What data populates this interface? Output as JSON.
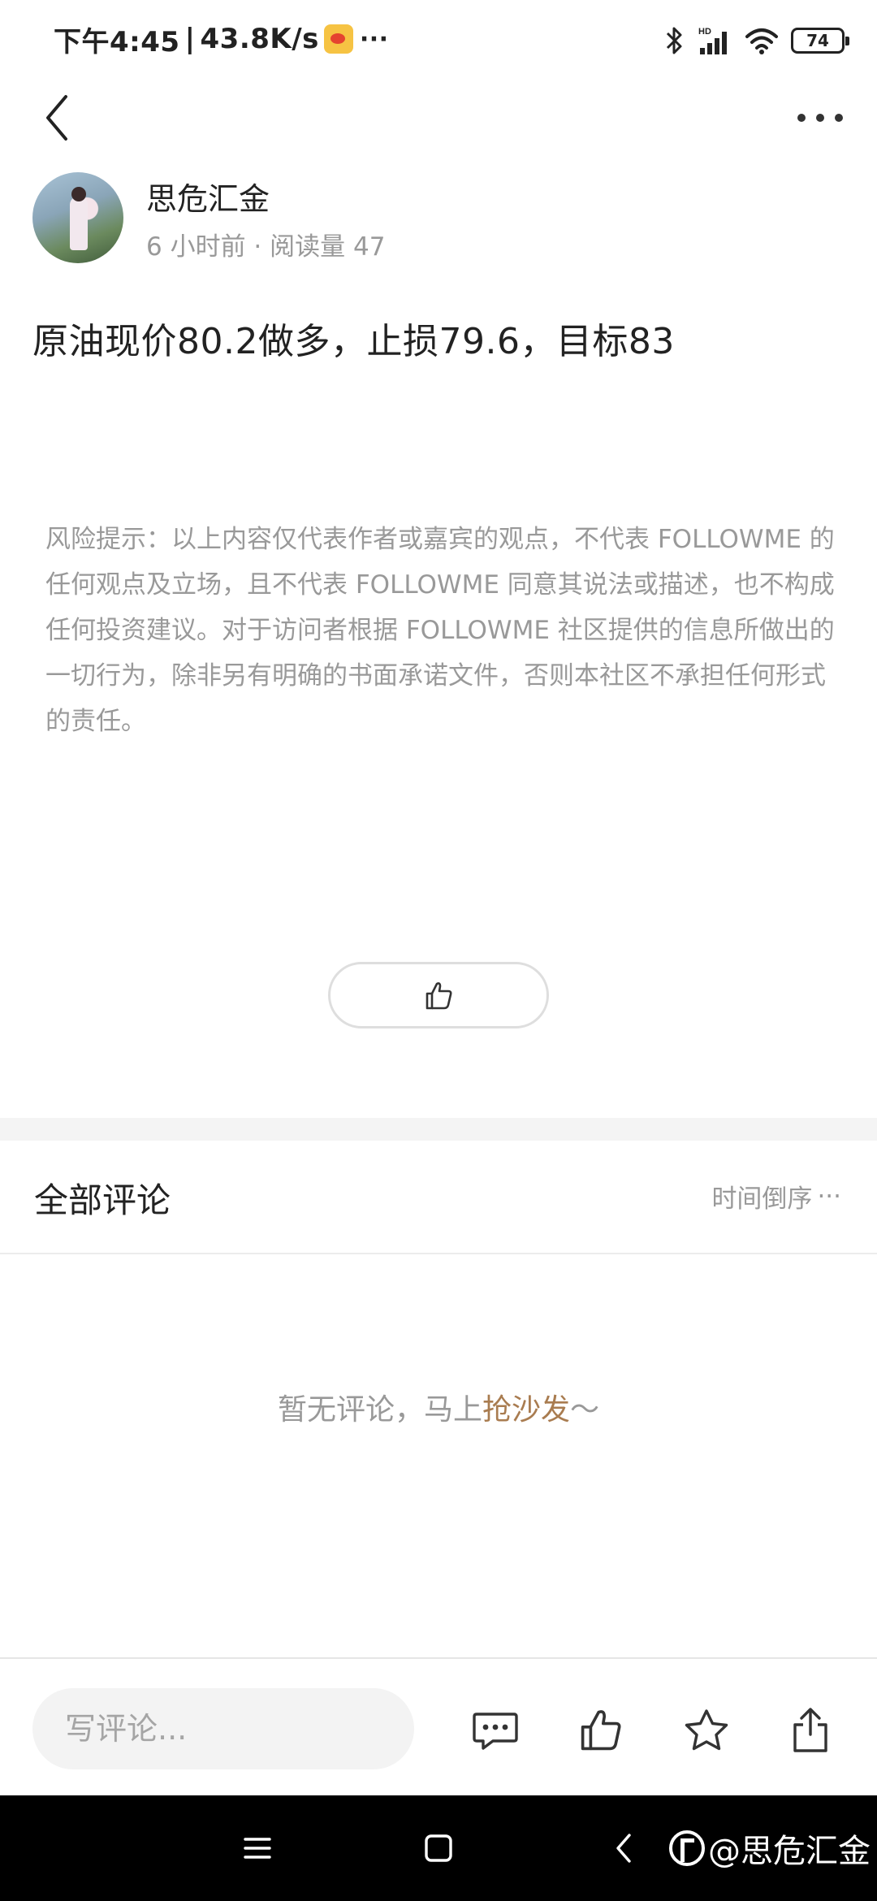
{
  "status_bar": {
    "time": "下午4:45",
    "separator": "|",
    "network_speed": "43.8K/s",
    "app_badge_icon": "weibo-icon",
    "overflow": "···",
    "bluetooth_icon": "bluetooth-icon",
    "signal_icon": "hd-signal-icon",
    "wifi_icon": "wifi-icon",
    "battery": "74"
  },
  "nav": {
    "back_icon": "chevron-left-icon",
    "more_icon": "more-horizontal-icon"
  },
  "post": {
    "author": "思危汇金",
    "meta": "6 小时前 · 阅读量 47",
    "content": "原油现价80.2做多，止损79.6，目标83",
    "disclaimer": "风险提示：以上内容仅代表作者或嘉宾的观点，不代表 FOLLOWME 的任何观点及立场，且不代表 FOLLOWME 同意其说法或描述，也不构成任何投资建议。对于访问者根据 FOLLOWME 社区提供的信息所做出的一切行为，除非另有明确的书面承诺文件，否则本社区不承担任何形式的责任。"
  },
  "comments": {
    "title": "全部评论",
    "sort_label": "时间倒序",
    "sort_icon": "···",
    "empty_prefix": "暂无评论，马上",
    "empty_cta": "抢沙发",
    "empty_suffix": "～"
  },
  "bottom_bar": {
    "input_placeholder": "写评论..."
  },
  "system_nav": {
    "watermark": "@思危汇金"
  },
  "colors": {
    "accent": "#a97c50",
    "text_primary": "#222222",
    "text_secondary": "#999999"
  }
}
